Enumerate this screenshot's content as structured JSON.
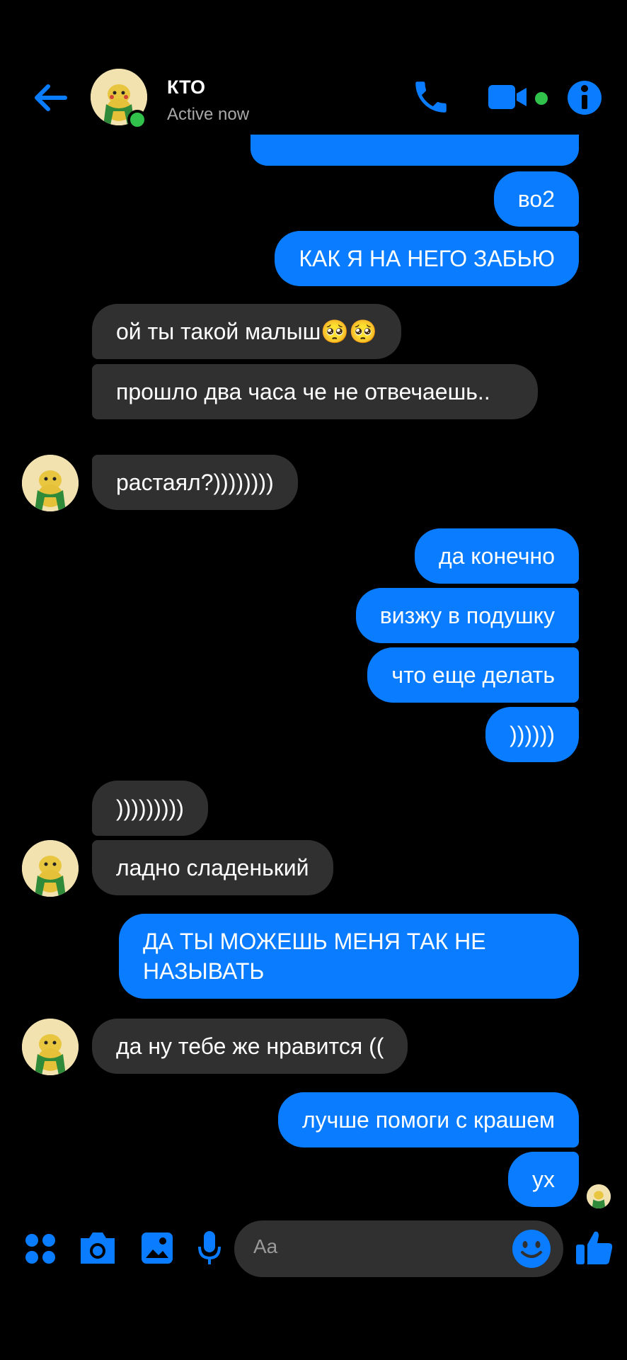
{
  "header": {
    "name": "КТО",
    "status": "Active now"
  },
  "messages": [
    {
      "dir": "out",
      "text": "во2"
    },
    {
      "dir": "out",
      "text": "КАК Я НА НЕГО ЗАБЬЮ"
    },
    {
      "dir": "in",
      "text": "ой ты такой малыш🥺🥺"
    },
    {
      "dir": "in",
      "text": "прошло два часа че не отвечаешь.."
    },
    {
      "dir": "in",
      "text": "растаял?))))))))"
    },
    {
      "dir": "out",
      "text": "да конечно"
    },
    {
      "dir": "out",
      "text": "визжу в подушку"
    },
    {
      "dir": "out",
      "text": "что еще делать"
    },
    {
      "dir": "out",
      "text": "))))))"
    },
    {
      "dir": "in",
      "text": ")))))))))"
    },
    {
      "dir": "in",
      "text": "ладно сладенький"
    },
    {
      "dir": "out",
      "text": "ДА ТЫ МОЖЕШЬ МЕНЯ ТАК НЕ НАЗЫВАТЬ"
    },
    {
      "dir": "in",
      "text": "да ну тебе же нравится (("
    },
    {
      "dir": "out",
      "text": "лучше помоги с крашем"
    },
    {
      "dir": "out",
      "text": "ух"
    }
  ],
  "composer": {
    "placeholder": "Aa"
  },
  "colors": {
    "accent": "#0a7cff",
    "incoming": "#303030",
    "online": "#31c24c"
  }
}
